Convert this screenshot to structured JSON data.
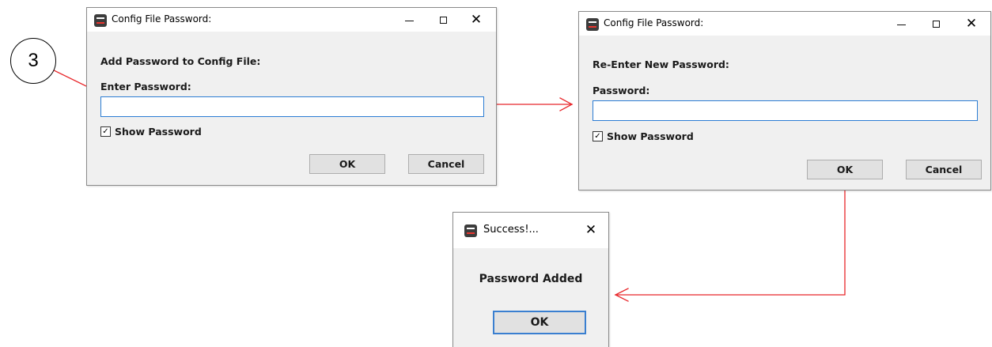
{
  "step_marker": "3",
  "dialog1": {
    "title": "Config File Password:",
    "heading": "Add Password to Config File:",
    "field_label": "Enter Password:",
    "field_value": "",
    "show_password_label": "Show Password",
    "show_password_checked": true,
    "check_glyph": "✓",
    "ok_label": "OK",
    "cancel_label": "Cancel"
  },
  "dialog2": {
    "title": "Config File Password:",
    "heading": "Re-Enter New Password:",
    "field_label": "Password:",
    "field_value": "",
    "show_password_label": "Show Password",
    "show_password_checked": true,
    "check_glyph": "✓",
    "ok_label": "OK",
    "cancel_label": "Cancel"
  },
  "dialog3": {
    "title": "Success!...",
    "message": "Password Added",
    "ok_label": "OK"
  },
  "icons": {
    "close": "✕"
  },
  "colors": {
    "arrow": "#e8262a",
    "input_border": "#2b7cd3",
    "focus_border": "#3a7fd0",
    "window_bg": "#f0f0f0"
  }
}
